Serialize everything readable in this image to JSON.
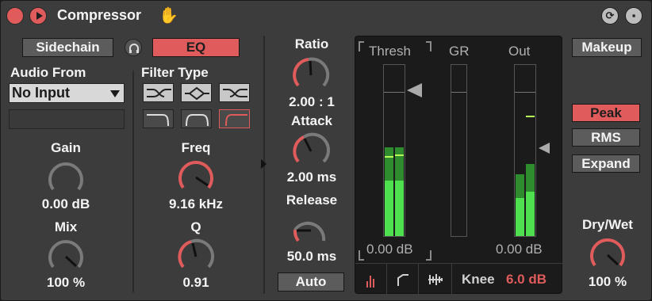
{
  "title": "Compressor",
  "titlebar": {
    "hot_swap_glyph": "⟳",
    "save_glyph": "▪"
  },
  "left": {
    "sidechain_label": "Sidechain",
    "eq_label": "EQ",
    "audio_from_label": "Audio From",
    "audio_from_value": "No Input",
    "gain_label": "Gain",
    "gain_value": "0.00 dB",
    "mix_label": "Mix",
    "mix_value": "100 %"
  },
  "filter": {
    "type_label": "Filter Type",
    "freq_label": "Freq",
    "freq_value": "9.16 kHz",
    "q_label": "Q",
    "q_value": "0.91",
    "types": [
      "lowpass",
      "bandpass",
      "highpass",
      "low-shelf",
      "bell",
      "high-shelf"
    ],
    "selected_index": 5
  },
  "dynamics": {
    "ratio_label": "Ratio",
    "ratio_value": "2.00 : 1",
    "attack_label": "Attack",
    "attack_value": "2.00 ms",
    "release_label": "Release",
    "release_value": "50.0 ms",
    "auto_label": "Auto"
  },
  "display": {
    "thresh_label": "Thresh",
    "gr_label": "GR",
    "out_label": "Out",
    "thresh_value": "0.00 dB",
    "out_value": "0.00 dB",
    "knee_label": "Knee",
    "knee_value": "6.0 dB",
    "meters": {
      "thresh": [
        0.52,
        0.52
      ],
      "out": [
        0.36,
        0.42
      ]
    }
  },
  "right": {
    "makeup_label": "Makeup",
    "peak_label": "Peak",
    "rms_label": "RMS",
    "expand_label": "Expand",
    "drywet_label": "Dry/Wet",
    "drywet_value": "100 %"
  },
  "colors": {
    "accent": "#e05b5b",
    "meter": "#4ee04e",
    "bg": "#3c3c3c"
  },
  "icons": {
    "power": "power-icon",
    "play": "play-icon",
    "hand": "hand-icon",
    "hot_swap": "hot-swap-icon",
    "save": "save-icon"
  }
}
